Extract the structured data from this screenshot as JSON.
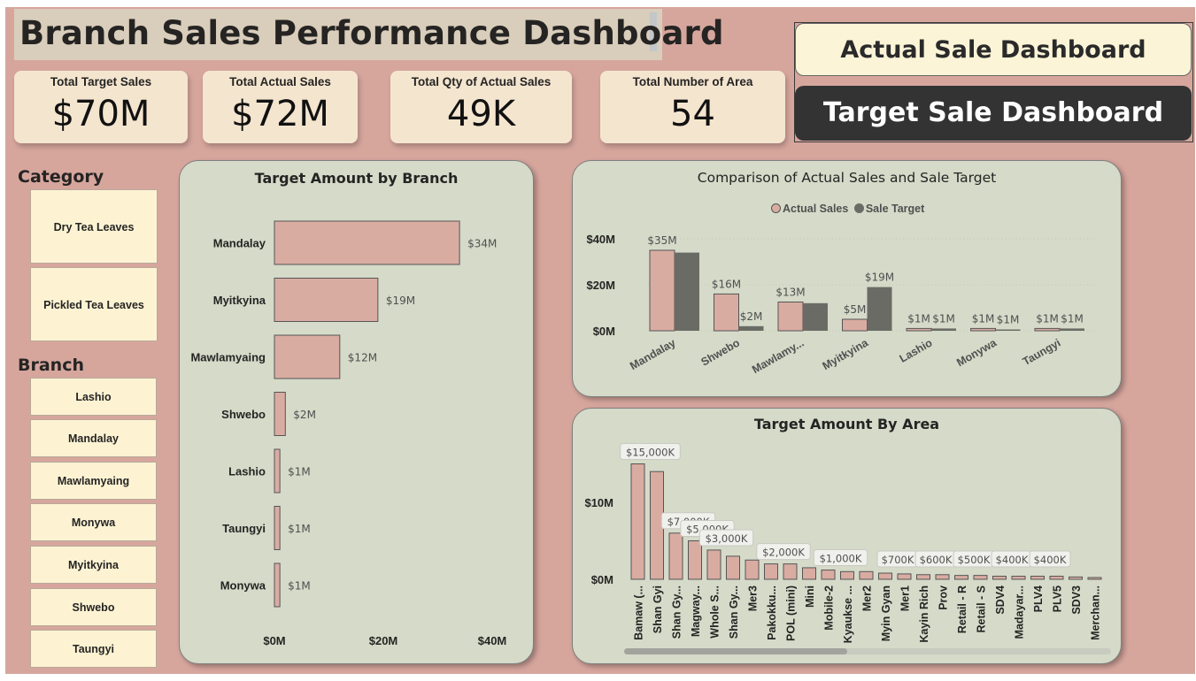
{
  "title": "Branch Sales Performance Dashboard",
  "kpis": [
    {
      "label": "Total Target Sales",
      "value": "$70M"
    },
    {
      "label": "Total Actual Sales",
      "value": "$72M"
    },
    {
      "label": "Total Qty of Actual Sales",
      "value": "49K"
    },
    {
      "label": "Total Number of Area",
      "value": "54"
    }
  ],
  "nav": {
    "actual_label": "Actual Sale Dashboard",
    "target_label": "Target Sale Dashboard"
  },
  "category": {
    "title": "Category",
    "items": [
      "Dry Tea Leaves",
      "Pickled Tea Leaves"
    ]
  },
  "branch": {
    "title": "Branch",
    "items": [
      "Lashio",
      "Mandalay",
      "Mawlamyaing",
      "Monywa",
      "Myitkyina",
      "Shwebo",
      "Taungyi"
    ]
  },
  "colors": {
    "background": "#d6a69d",
    "panel": "#d5dac9",
    "bar_actual": "#d9aca2",
    "bar_target": "#6b6b66",
    "slicer": "#fdf3d3",
    "kpi": "#f4e5cf"
  },
  "chart_data": [
    {
      "type": "bar",
      "orientation": "horizontal",
      "title": "Target Amount by Branch",
      "categories": [
        "Mandalay",
        "Myitkyina",
        "Mawlamyaing",
        "Shwebo",
        "Lashio",
        "Taungyi",
        "Monywa"
      ],
      "values": [
        34,
        19,
        12,
        2,
        1,
        1,
        1
      ],
      "data_labels": [
        "$34M",
        "$19M",
        "$12M",
        "$2M",
        "$1M",
        "$1M",
        "$1M"
      ],
      "xlim": [
        0,
        40
      ],
      "x_ticks": [
        "$0M",
        "$20M",
        "$40M"
      ],
      "grid": false
    },
    {
      "type": "bar",
      "title": "Comparison of Actual Sales and Sale Target",
      "categories": [
        "Mandalay",
        "Shwebo",
        "Mawlamy...",
        "Myitkyina",
        "Lashio",
        "Monywa",
        "Taungyi"
      ],
      "series": [
        {
          "name": "Actual Sales",
          "values": [
            35,
            16,
            12.5,
            5,
            1,
            1,
            1
          ],
          "data_labels": [
            "$35M",
            "$16M",
            "$13M",
            "$5M",
            "$1M",
            "$1M",
            "$1M"
          ]
        },
        {
          "name": "Sale Target",
          "values": [
            34,
            2,
            12,
            19,
            1,
            0.5,
            1
          ],
          "data_labels": [
            "",
            "$2M",
            "",
            "$19M",
            "$1M",
            "$1M",
            "$1M"
          ]
        }
      ],
      "ylim": [
        0,
        40
      ],
      "y_ticks": [
        "$0M",
        "$20M",
        "$40M"
      ],
      "legend": "top-center",
      "grid": true
    },
    {
      "type": "bar",
      "title": "Target Amount By Area",
      "categories": [
        "Bamaw (...",
        "Shan Gyi",
        "Shan Gy...",
        "Magway...",
        "Whole S...",
        "Shan Gy...",
        "Mer3",
        "Pakokku...",
        "POL (mini)",
        "Mini",
        "Mobile-2",
        "Kyaukse ...",
        "Mer2",
        "Myin Gyan",
        "Mer1",
        "Kayin Rich",
        "Prov",
        "Retail - R",
        "Retail - S",
        "SDV4",
        "Madayar...",
        "PLV4",
        "PLV5",
        "SDV3",
        "Merchan..."
      ],
      "values": [
        15000,
        14000,
        6000,
        5000,
        3800,
        3000,
        2500,
        2000,
        2000,
        1500,
        1200,
        1000,
        1000,
        800,
        700,
        600,
        600,
        500,
        500,
        400,
        400,
        400,
        400,
        300,
        200
      ],
      "data_labels": [
        "$15,000K",
        "",
        "$7,000K",
        "$5,000K",
        "$3,000K",
        "",
        "",
        "$2,000K",
        "",
        "",
        "$1,000K",
        "",
        "",
        "$700K",
        "",
        "$600K",
        "",
        "$500K",
        "",
        "$400K",
        "",
        "$400K",
        "",
        "",
        ""
      ],
      "ylim": [
        0,
        15000
      ],
      "y_ticks": [
        "$0M",
        "$10M"
      ],
      "grid": false
    }
  ]
}
